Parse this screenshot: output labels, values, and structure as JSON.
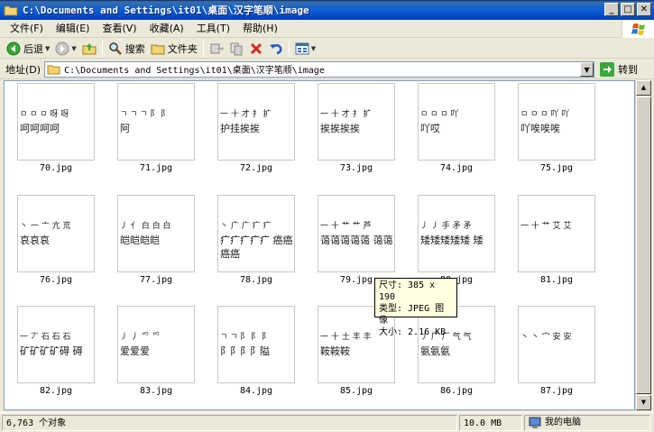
{
  "window": {
    "title": "C:\\Documents and Settings\\it01\\桌面\\汉字笔顺\\image",
    "minimize": "_",
    "maximize": "□",
    "close": "✕"
  },
  "menu": {
    "items": [
      {
        "label": "文件(F)"
      },
      {
        "label": "编辑(E)"
      },
      {
        "label": "查看(V)"
      },
      {
        "label": "收藏(A)"
      },
      {
        "label": "工具(T)"
      },
      {
        "label": "帮助(H)"
      }
    ]
  },
  "toolbar": {
    "back": "后退",
    "search": "搜索",
    "folders": "文件夹"
  },
  "address": {
    "label": "地址(D)",
    "path": "C:\\Documents and Settings\\it01\\桌面\\汉字笔顺\\image",
    "go": "转到"
  },
  "thumbnails": [
    {
      "name": "70.jpg",
      "row1": "ㅁ ㅁ ㅁ 呀 呀",
      "row2": "呵呵呵呵"
    },
    {
      "name": "71.jpg",
      "row1": "ㄱ ㄱ ㄱ 阝 阝",
      "row2": "阿"
    },
    {
      "name": "72.jpg",
      "row1": "一 十 才 扌 扩",
      "row2": "护挂挨挨"
    },
    {
      "name": "73.jpg",
      "row1": "一 十 才 扌 扩",
      "row2": "挨挨挨挨"
    },
    {
      "name": "74.jpg",
      "row1": "ㅁ ㅁ ㅁ 吖",
      "row2": "吖哎"
    },
    {
      "name": "75.jpg",
      "row1": "ㅁ ㅁ ㅁ 吖 吖",
      "row2": "吖唉唉唉"
    },
    {
      "name": "76.jpg",
      "row1": "丶 一 亠 亢 㐬",
      "row2": "哀哀哀"
    },
    {
      "name": "77.jpg",
      "row1": "丿 亻 白 白 白",
      "row2": "皑皑皑皑"
    },
    {
      "name": "78.jpg",
      "row1": "丶 广 广 疒 疒",
      "row2": "疒疒疒疒疒 癌癌癌癌"
    },
    {
      "name": "79.jpg",
      "row1": "一 十 艹 艹 芦",
      "row2": "蔼蔼蔼蔼蔼 蔼蔼"
    },
    {
      "name": "80.jpg",
      "row1": "丿 丿 手 矛 矛",
      "row2": "矮矮矮矮矮 矮"
    },
    {
      "name": "81.jpg",
      "row1": "一 十 艹 艾 艾",
      "row2": ""
    },
    {
      "name": "82.jpg",
      "row1": "一 丆 石 石 石",
      "row2": "矿矿矿矿碍 碍"
    },
    {
      "name": "83.jpg",
      "row1": "丿 丿 爫 爫",
      "row2": "爱爱爱"
    },
    {
      "name": "84.jpg",
      "row1": "ㄱ ㄱ 阝 阝 阝",
      "row2": "阝阝阝阝隘"
    },
    {
      "name": "85.jpg",
      "row1": "一 十 土 丰 丰",
      "row2": "鞍鞍鞍"
    },
    {
      "name": "86.jpg",
      "row1": "丿 厂 厂 气 气",
      "row2": "氨氨氨"
    },
    {
      "name": "87.jpg",
      "row1": "丶 丶 宀 安 安",
      "row2": ""
    }
  ],
  "tooltip": {
    "size": "尺寸: 385 x 190",
    "type": "类型: JPEG 图像",
    "filesize": "大小: 2.16 KB"
  },
  "status": {
    "objects": "6,763 个对象",
    "size": "10.0 MB",
    "location": "我的电脑"
  }
}
